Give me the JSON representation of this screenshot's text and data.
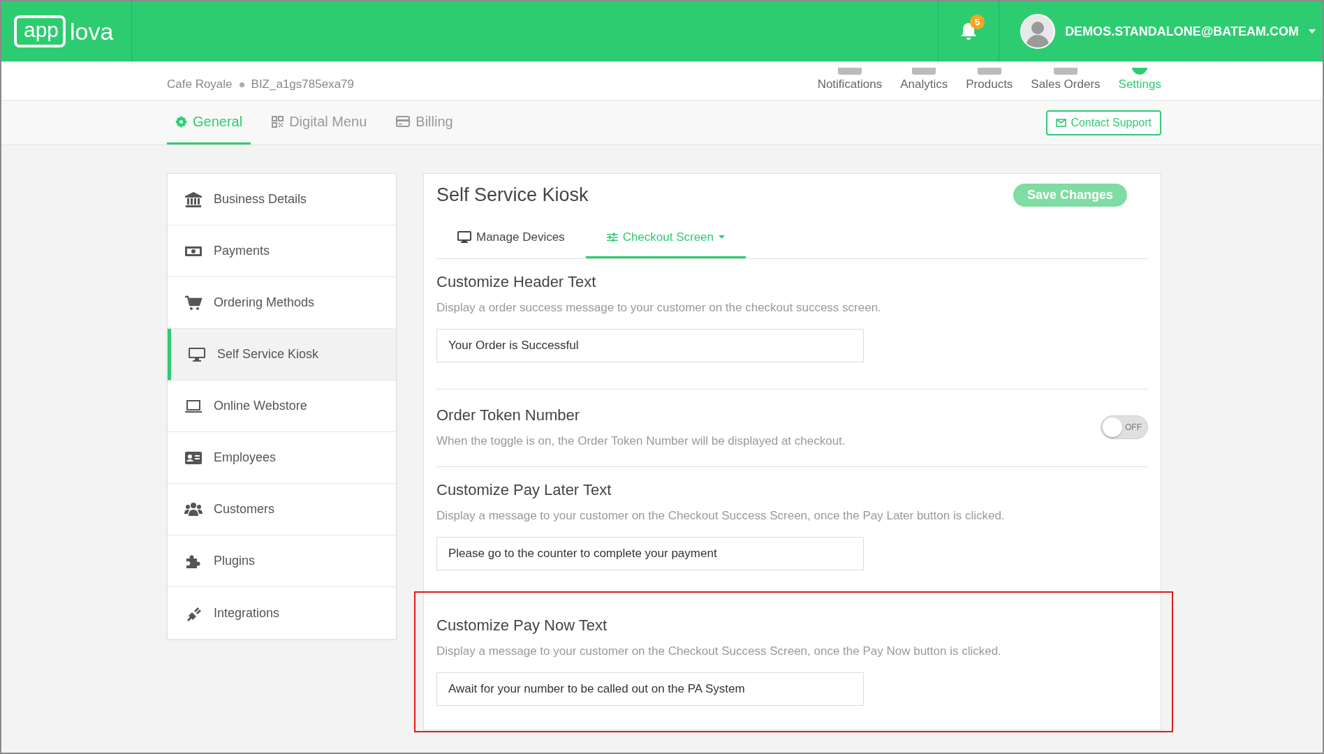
{
  "header": {
    "logo_box": "app",
    "logo_rest": "lova",
    "notifications_count": "5",
    "user": "DEMOS.STANDALONE@BATEAM.COM"
  },
  "business": {
    "name": "Cafe Royale",
    "id": "BIZ_a1gs785exa79"
  },
  "top_nav": [
    {
      "label": "Notifications",
      "selected": false
    },
    {
      "label": "Analytics",
      "selected": false
    },
    {
      "label": "Products",
      "selected": false
    },
    {
      "label": "Sales Orders",
      "selected": false
    },
    {
      "label": "Settings",
      "selected": true
    }
  ],
  "tabs": [
    {
      "label": "General",
      "selected": true
    },
    {
      "label": "Digital Menu",
      "selected": false
    },
    {
      "label": "Billing",
      "selected": false
    }
  ],
  "contact_button": "Contact Support",
  "sidebar": {
    "items": [
      {
        "label": "Business Details",
        "selected": false
      },
      {
        "label": "Payments",
        "selected": false
      },
      {
        "label": "Ordering Methods",
        "selected": false
      },
      {
        "label": "Self Service Kiosk",
        "selected": true
      },
      {
        "label": "Online Webstore",
        "selected": false
      },
      {
        "label": "Employees",
        "selected": false
      },
      {
        "label": "Customers",
        "selected": false
      },
      {
        "label": "Plugins",
        "selected": false
      },
      {
        "label": "Integrations",
        "selected": false
      }
    ]
  },
  "panel": {
    "title": "Self Service Kiosk",
    "save_button": "Save Changes",
    "subtabs": [
      {
        "label": "Manage Devices",
        "selected": false
      },
      {
        "label": "Checkout Screen",
        "selected": true
      }
    ],
    "sections": [
      {
        "kind": "input",
        "title": "Customize Header Text",
        "description": "Display a order success message to your customer on the checkout success screen.",
        "value": "Your Order is Successful",
        "highlighted": false
      },
      {
        "kind": "toggle",
        "title": "Order Token Number",
        "description": "When the toggle is on, the Order Token Number will be displayed at checkout.",
        "on": false,
        "toggle_label": "OFF",
        "highlighted": false
      },
      {
        "kind": "input",
        "title": "Customize Pay Later Text",
        "description": "Display a message to your customer on the Checkout Success Screen, once the Pay Later button is clicked.",
        "value": "Please go to the counter to complete your payment",
        "highlighted": false
      },
      {
        "kind": "input",
        "title": "Customize Pay Now Text",
        "description": "Display a message to your customer on the Checkout Success Screen, once the Pay Now button is clicked.",
        "value": "Await for your number to be called out on the PA System",
        "highlighted": true
      }
    ]
  }
}
